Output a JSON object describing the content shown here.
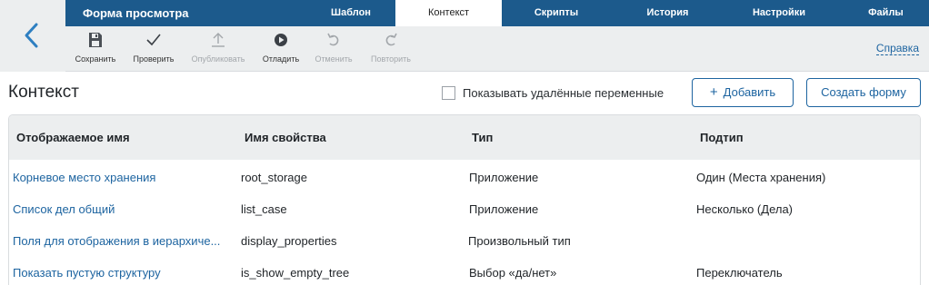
{
  "header": {
    "form_title": "Форма просмотра",
    "tabs": [
      {
        "label": "Шаблон",
        "active": false
      },
      {
        "label": "Контекст",
        "active": true
      },
      {
        "label": "Скрипты",
        "active": false
      },
      {
        "label": "История",
        "active": false
      },
      {
        "label": "Настройки",
        "active": false
      },
      {
        "label": "Файлы",
        "active": false
      }
    ]
  },
  "toolbar": {
    "items": [
      {
        "label": "Сохранить",
        "icon": "save-icon",
        "enabled": true
      },
      {
        "label": "Проверить",
        "icon": "check-icon",
        "enabled": true
      },
      {
        "label": "Опубликовать",
        "icon": "publish-icon",
        "enabled": false
      },
      {
        "label": "Отладить",
        "icon": "debug-play-icon",
        "enabled": true
      },
      {
        "label": "Отменить",
        "icon": "undo-icon",
        "enabled": false
      },
      {
        "label": "Повторить",
        "icon": "redo-icon",
        "enabled": false
      }
    ],
    "help_label": "Справка"
  },
  "page": {
    "title": "Контекст",
    "show_deleted_label": "Показывать удалённые переменные",
    "show_deleted_checked": false,
    "add_button_label": "Добавить",
    "create_form_label": "Создать форму"
  },
  "table": {
    "columns": [
      "Отображаемое имя",
      "Имя свойства",
      "Тип",
      "Подтип"
    ],
    "rows": [
      {
        "name": "Корневое место хранения",
        "property": "root_storage",
        "type": "Приложение",
        "subtype": "Один (Места хранения)"
      },
      {
        "name": "Список дел общий",
        "property": "list_case",
        "type": "Приложение",
        "subtype": "Несколько (Дела)"
      },
      {
        "name": "Поля для отображения в иерархиче...",
        "property": "display_properties",
        "type": "Произвольный тип",
        "subtype": ""
      },
      {
        "name": "Показать пустую структуру",
        "property": "is_show_empty_tree",
        "type": "Выбор «да/нет»",
        "subtype": "Переключатель"
      }
    ]
  },
  "colors": {
    "brand": "#1c5a8c",
    "link": "#1d64a0",
    "toolbar_bg": "#eceeef"
  }
}
